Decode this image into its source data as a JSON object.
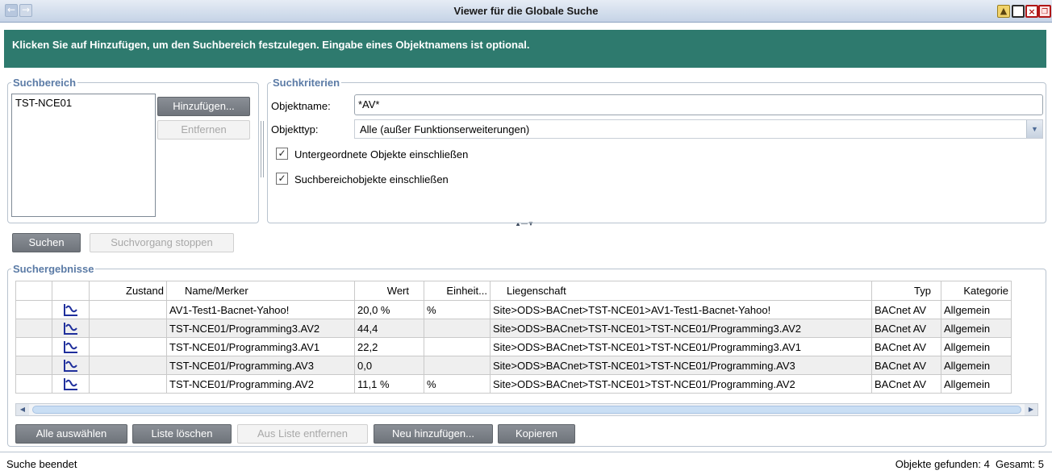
{
  "window": {
    "title": "Viewer für die Globale Suche",
    "icons": [
      "arrow-left-icon",
      "arrow-right-icon",
      "lock-icon",
      "maximize-icon",
      "close-icon",
      "restore-icon"
    ]
  },
  "banner": {
    "text": "Klicken Sie auf Hinzufügen, um den Suchbereich festzulegen. Eingabe eines Objektnamens ist optional."
  },
  "suchbereich": {
    "legend": "Suchbereich",
    "items": [
      "TST-NCE01"
    ],
    "add_label": "Hinzufügen...",
    "remove_label": "Entfernen"
  },
  "kriterien": {
    "legend": "Suchkriterien",
    "objektname_label": "Objektname:",
    "objektname_value": "*AV*",
    "objekttyp_label": "Objekttyp:",
    "objekttyp_value": "Alle (außer Funktionserweiterungen)",
    "check1_label": "Untergeordnete Objekte einschließen",
    "check1_checked": true,
    "check2_label": "Suchbereichobjekte einschließen",
    "check2_checked": true
  },
  "actions": {
    "search_label": "Suchen",
    "stop_label": "Suchvorgang stoppen"
  },
  "results": {
    "legend": "Suchergebnisse",
    "columns": [
      "",
      "",
      "Zustand",
      "Name/Merker",
      "Wert",
      "Einheit...",
      "Liegenschaft",
      "Typ",
      "Kategorie"
    ],
    "rows": [
      {
        "zustand": "",
        "name": "AV1-Test1-Bacnet-Yahoo!",
        "wert": "20,0 %",
        "einheit": "%",
        "liegenschaft": "Site>ODS>BACnet>TST-NCE01>AV1-Test1-Bacnet-Yahoo!",
        "typ": "BACnet AV",
        "kategorie": "Allgemein"
      },
      {
        "zustand": "",
        "name": "TST-NCE01/Programming3.AV2",
        "wert": "44,4",
        "einheit": "",
        "liegenschaft": "Site>ODS>BACnet>TST-NCE01>TST-NCE01/Programming3.AV2",
        "typ": "BACnet AV",
        "kategorie": "Allgemein"
      },
      {
        "zustand": "",
        "name": "TST-NCE01/Programming3.AV1",
        "wert": "22,2",
        "einheit": "",
        "liegenschaft": "Site>ODS>BACnet>TST-NCE01>TST-NCE01/Programming3.AV1",
        "typ": "BACnet AV",
        "kategorie": "Allgemein"
      },
      {
        "zustand": "",
        "name": "TST-NCE01/Programming.AV3",
        "wert": "0,0",
        "einheit": "",
        "liegenschaft": "Site>ODS>BACnet>TST-NCE01>TST-NCE01/Programming.AV3",
        "typ": "BACnet AV",
        "kategorie": "Allgemein"
      },
      {
        "zustand": "",
        "name": "TST-NCE01/Programming.AV2",
        "wert": "11,1 %",
        "einheit": "%",
        "liegenschaft": "Site>ODS>BACnet>TST-NCE01>TST-NCE01/Programming.AV2",
        "typ": "BACnet AV",
        "kategorie": "Allgemein"
      }
    ],
    "row_icon": "trend-icon"
  },
  "bottom_buttons": {
    "select_all": "Alle auswählen",
    "clear_list": "Liste löschen",
    "remove_from_list": "Aus Liste entfernen",
    "add_new": "Neu hinzufügen...",
    "copy": "Kopieren"
  },
  "status": {
    "left": "Suche beendet",
    "right": "Objekte gefunden: 4  Gesamt: 5"
  },
  "colors": {
    "banner": "#2e7a6e",
    "legend": "#5b7ba6",
    "dark_button": "#777c83",
    "trend_icon": "#1f2f9c"
  }
}
